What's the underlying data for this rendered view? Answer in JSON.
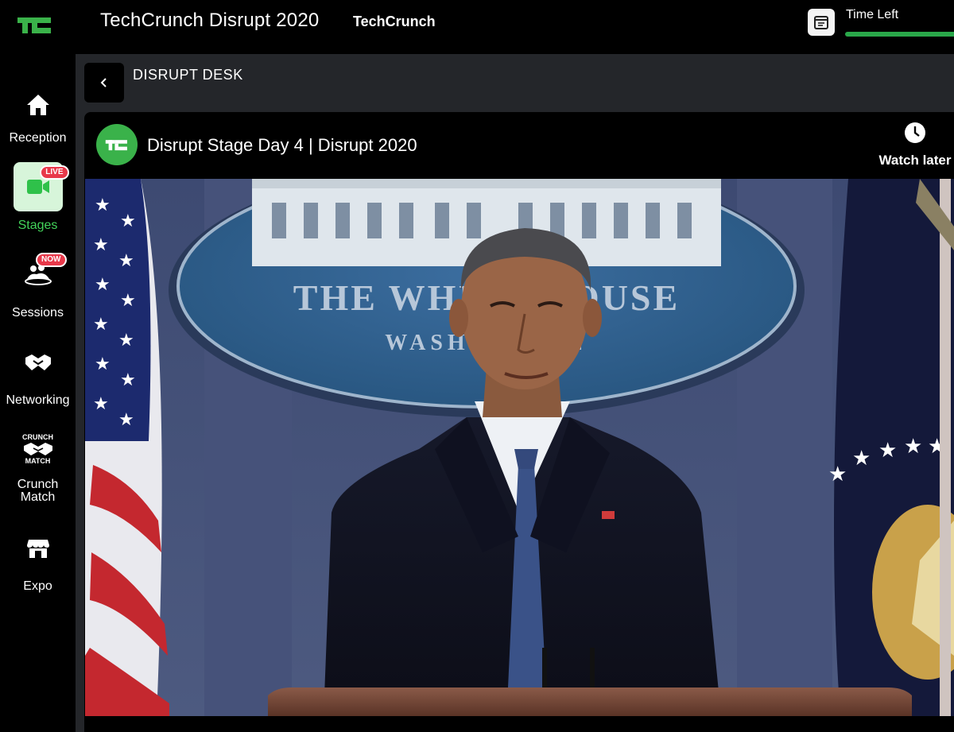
{
  "header": {
    "event_title": "TechCrunch Disrupt 2020",
    "org_name": "TechCrunch",
    "time_left_label": "Time Left",
    "time_left_progress": 1.0
  },
  "sidebar": {
    "items": [
      {
        "label": "Reception",
        "icon": "home-icon"
      },
      {
        "label": "Stages",
        "icon": "video-camera-icon",
        "badge": "LIVE",
        "active": true
      },
      {
        "label": "Sessions",
        "icon": "audience-icon",
        "badge": "NOW"
      },
      {
        "label": "Networking",
        "icon": "handshake-icon"
      },
      {
        "label": "Crunch\nMatch",
        "icon": "crunch-match-icon",
        "icon_text_top": "CRUNCH",
        "icon_text_bottom": "MATCH"
      },
      {
        "label": "Expo",
        "icon": "storefront-icon"
      }
    ]
  },
  "main": {
    "section_title": "DISRUPT DESK",
    "stream": {
      "title": "Disrupt Stage Day 4 | Disrupt 2020",
      "watch_later_label": "Watch later",
      "seal_text_top": "THE WHITE HOUSE",
      "seal_text_bottom": "WASHINGTON"
    }
  },
  "colors": {
    "accent_green": "#43d35a",
    "brand_green": "#3ab24a",
    "live_red": "#e8384a",
    "background": "#000000",
    "panel": "#24262a"
  }
}
